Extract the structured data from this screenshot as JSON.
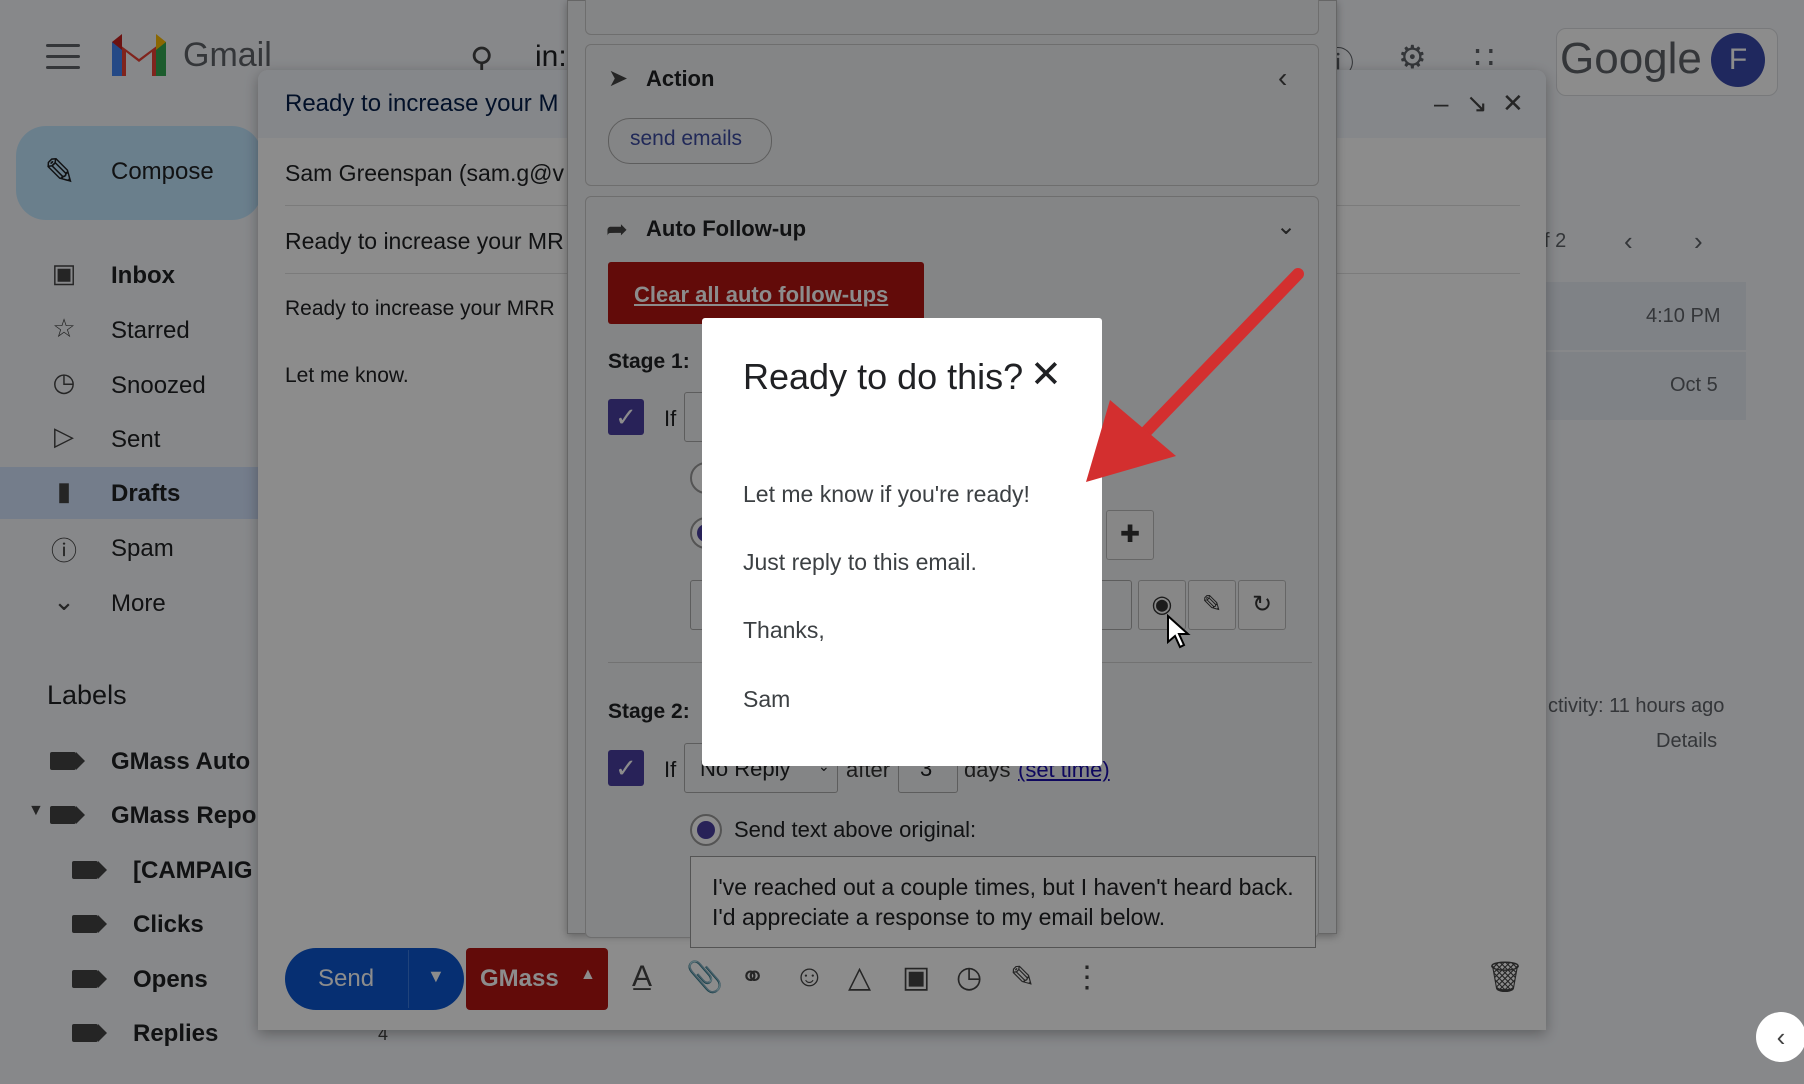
{
  "app": {
    "name": "Gmail",
    "search_prefix": "in:",
    "google_word": "Google",
    "avatar_letter": "F"
  },
  "sidebar": {
    "compose_label": "Compose",
    "items": [
      {
        "label": "Inbox"
      },
      {
        "label": "Starred"
      },
      {
        "label": "Snoozed"
      },
      {
        "label": "Sent"
      },
      {
        "label": "Drafts"
      },
      {
        "label": "Spam"
      },
      {
        "label": "More"
      }
    ],
    "labels_heading": "Labels",
    "labels": [
      {
        "label": "GMass Auto"
      },
      {
        "label": "GMass Repo"
      },
      {
        "label": "[CAMPAIG"
      },
      {
        "label": "Clicks"
      },
      {
        "label": "Opens"
      },
      {
        "label": "Replies",
        "count": "4"
      }
    ]
  },
  "list": {
    "page_fragment": "f 2",
    "rows": [
      {
        "time": "4:10 PM"
      },
      {
        "time": "Oct 5"
      }
    ],
    "activity": "ctivity: 11 hours ago",
    "details": "Details"
  },
  "compose": {
    "title": "Ready to increase your M",
    "to": "Sam Greenspan (sam.g@v",
    "subject": "Ready to increase your MR",
    "body_line1": "Ready to increase your MRR",
    "body_line2": "Let me know.",
    "send_label": "Send",
    "gmass_label": "GMass"
  },
  "gmass_panel": {
    "action_title": "Action",
    "action_pill": "send emails",
    "followup_title": "Auto Follow-up",
    "clear_button": "Clear all auto follow-ups",
    "stage1_label": "Stage 1:",
    "stage2_label": "Stage 2:",
    "if_label": "If",
    "stage2_condition": "No Reply",
    "after_label": "after",
    "days_value": "3",
    "days_label": "days",
    "set_time_link": "(set time)",
    "radio_label": "Send text above original:",
    "followup_text": "I've reached out a couple times, but I haven't heard back. I'd appreciate a response to my email below."
  },
  "dialog": {
    "title": "Ready to do this?",
    "lines": [
      "Let me know if you're ready!",
      "Just reply to this email.",
      "Thanks,",
      "Sam"
    ]
  },
  "colors": {
    "annotation_arrow": "#d32f2f",
    "gmass_red": "#b31412",
    "send_blue": "#0b57d0"
  }
}
